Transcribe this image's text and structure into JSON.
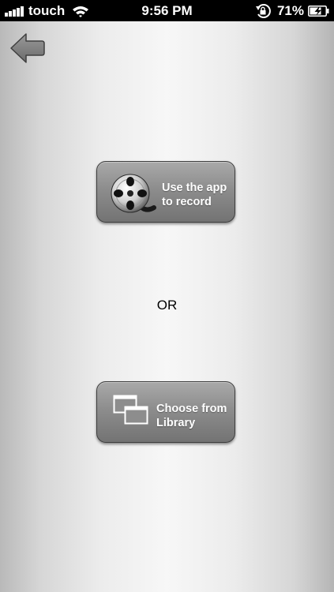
{
  "status_bar": {
    "carrier": "touch",
    "time": "9:56 PM",
    "battery_percent": "71%",
    "icons": [
      "signal-icon",
      "wifi-icon",
      "rotation-lock-icon",
      "battery-charging-icon"
    ]
  },
  "nav": {
    "back_icon": "arrow-left-icon"
  },
  "record_button": {
    "line1": "Use the app",
    "line2": "to record",
    "icon": "film-reel-icon"
  },
  "separator": {
    "text": "OR"
  },
  "library_button": {
    "line1": "Choose from",
    "line2": "Library",
    "icon": "stacked-windows-icon"
  },
  "colors": {
    "button_gray": "#8d8d8d",
    "status_bar": "#000000",
    "background_center": "#f7f7f7"
  }
}
